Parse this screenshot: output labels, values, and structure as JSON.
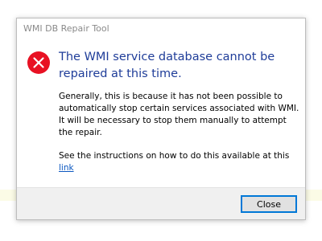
{
  "window": {
    "title": "WMI DB Repair Tool"
  },
  "message": {
    "icon": "error-icon",
    "icon_color": "#e81123",
    "headline": "The WMI service database cannot be repaired at this time.",
    "paragraph1": "Generally, this is because it has not been possible to automatically stop certain services associated with WMI. It will be necessary to stop them manually to attempt the repair.",
    "paragraph2_prefix": "See the instructions on how to do this available at this",
    "link_text": "link"
  },
  "footer": {
    "close_label": "Close",
    "accent": "#0078d7"
  }
}
